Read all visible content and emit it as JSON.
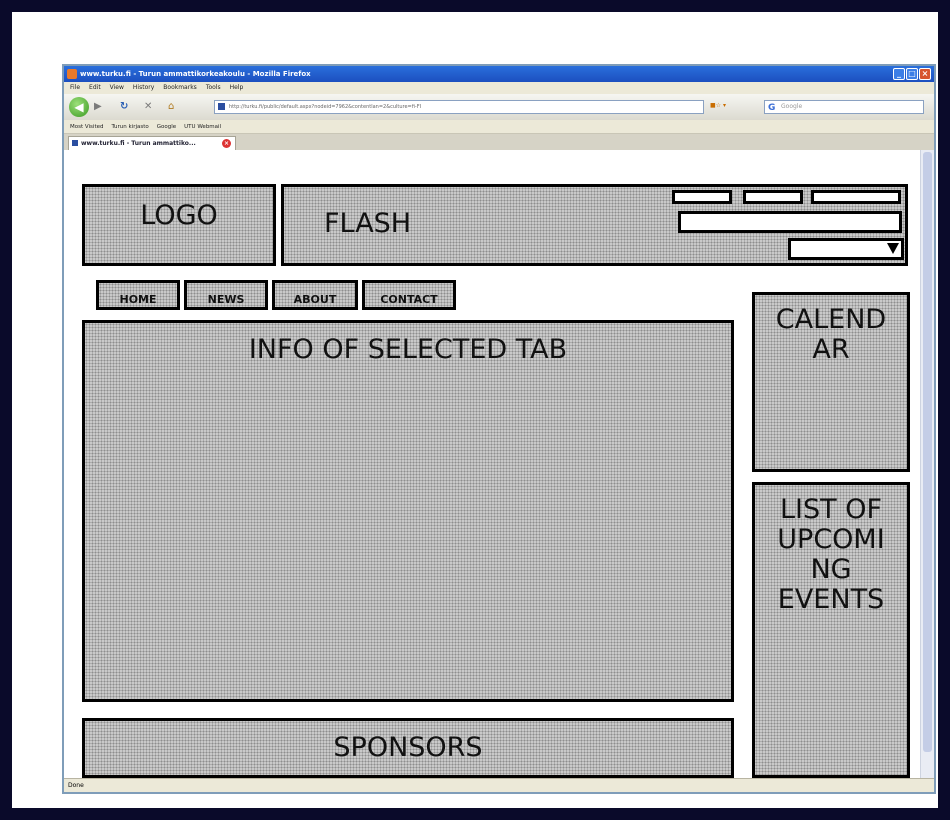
{
  "browser": {
    "title": "www.turku.fi - Turun ammattikorkeakoulu - Mozilla Firefox",
    "menu": [
      "File",
      "Edit",
      "View",
      "History",
      "Bookmarks",
      "Tools",
      "Help"
    ],
    "url": "http://turku.fi/public/default.aspx?nodeid=7962&contentlan=2&culture=fi-FI",
    "search_placeholder": "Google",
    "bookmarks": [
      "Most Visited",
      "Turun kirjasto",
      "Google",
      "UTU Webmail"
    ],
    "tab_title": "www.turku.fi - Turun ammattiko...",
    "status": "Done"
  },
  "wireframe": {
    "logo": "LOGO",
    "flash": "FLASH",
    "nav_tabs": [
      "HOME",
      "NEWS",
      "ABOUT",
      "CONTACT"
    ],
    "main": "INFO OF SELECTED TAB",
    "calendar_line1": "CALEND",
    "calendar_line2": "AR",
    "events_line1": "LIST OF",
    "events_line2": "UPCOMI",
    "events_line3": "NG",
    "events_line4": "EVENTS",
    "sponsors": "SPONSORS"
  },
  "colors": {
    "frame": "#0a0a2a",
    "box_fill": "#c9c9c9",
    "titlebar": "#2a6fdc"
  },
  "icons": [
    "back-arrow-icon",
    "forward-arrow-icon",
    "reload-icon",
    "stop-icon",
    "home-icon",
    "dropdown-arrow-icon"
  ]
}
